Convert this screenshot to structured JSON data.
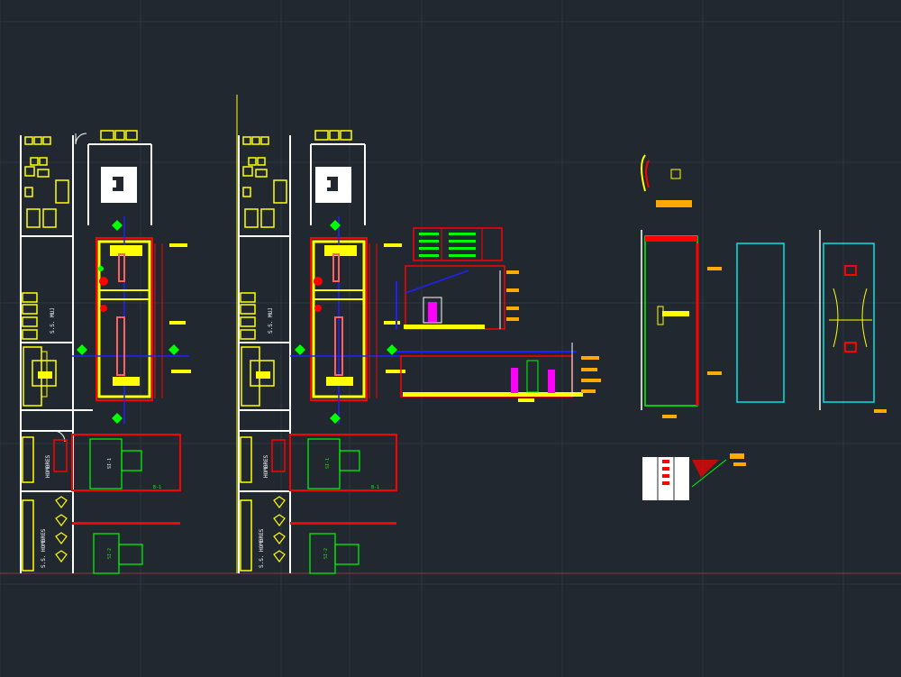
{
  "app": {
    "view": "cad-model-space"
  },
  "colors": {
    "background": "#212830",
    "grid": "#2d3640",
    "axis_x": "#8b3a3a",
    "white": "#ffffff",
    "yellow": "#ffff00",
    "red": "#ff0000",
    "green": "#00ff00",
    "blue": "#2020ff",
    "cyan": "#00e5e5",
    "magenta": "#ff00ff",
    "orange": "#ffaa00"
  },
  "labels": {
    "plan1_room_vertical": "S.S. MUJ",
    "plan1_hombres_upper": "HOMBRES",
    "plan1_hombres_lower": "S.S. HOMBRES",
    "plan2_room_vertical": "S.S. MUJ",
    "plan2_hombres_upper": "HOMBRES",
    "plan2_hombres_lower": "S.S. HOMBRES",
    "room_tag_a": "SI-1",
    "room_tag_b": "SI-2",
    "room_tag_c": "SI-1",
    "room_tag_d": "SI-2",
    "section_tag": "B-1",
    "section_tag_2": "B-1"
  },
  "icons": {
    "section_marker": "diamond-section-marker-icon"
  }
}
